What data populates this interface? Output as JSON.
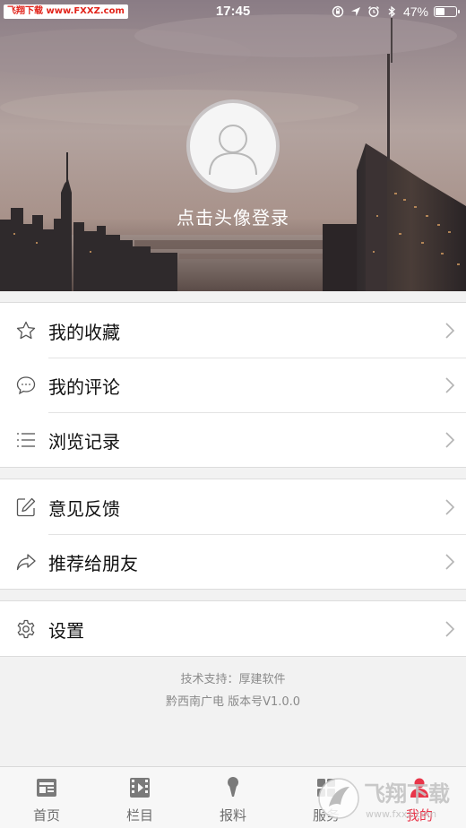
{
  "watermark": "飞翔下载 www.FXXZ.com",
  "status": {
    "time": "17:45",
    "battery_percent": "47%",
    "battery_level": 0.47
  },
  "profile": {
    "login_prompt": "点击头像登录",
    "avatar_icon": "person-icon"
  },
  "menu_groups": [
    [
      {
        "label": "我的收藏",
        "icon": "star-icon"
      },
      {
        "label": "我的评论",
        "icon": "comment-icon"
      },
      {
        "label": "浏览记录",
        "icon": "list-icon"
      }
    ],
    [
      {
        "label": "意见反馈",
        "icon": "edit-icon"
      },
      {
        "label": "推荐给朋友",
        "icon": "share-icon"
      }
    ],
    [
      {
        "label": "设置",
        "icon": "gear-icon"
      }
    ]
  ],
  "footer": {
    "support": "技术支持：厚建软件",
    "version": "黔西南广电  版本号V1.0.0"
  },
  "tabs": [
    {
      "label": "首页",
      "icon": "news-icon"
    },
    {
      "label": "栏目",
      "icon": "film-icon"
    },
    {
      "label": "报料",
      "icon": "microphone-icon"
    },
    {
      "label": "服务",
      "icon": "service-icon"
    },
    {
      "label": "我的",
      "icon": "user-icon",
      "active": true
    }
  ],
  "brand_watermark": "飞翔下载",
  "brand_watermark_url": "www.fxxz.com",
  "colors": {
    "accent": "#e8364a",
    "watermark_red": "#e2231a"
  }
}
